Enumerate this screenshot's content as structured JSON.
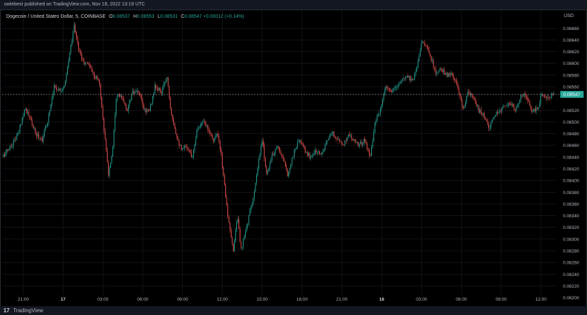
{
  "header": {
    "publish_text": "owlebest published on TradingView.com, Nov 18, 2022 13:19 UTC"
  },
  "legend": {
    "symbol": "Dogecoin / United States Dollar, 5, COINBASE",
    "o_label": "O",
    "o_value": "0.08537",
    "h_label": "H",
    "h_value": "0.08553",
    "l_label": "L",
    "l_value": "0.08531",
    "c_label": "C",
    "c_value": "0.08547",
    "change": "+0.00012 (+0.14%)"
  },
  "footer": {
    "logo_text": "17",
    "brand": "TradingView"
  },
  "chart_data": {
    "type": "candlestick",
    "currency_label": "USD",
    "ylim": [
      0.0821,
      0.08672
    ],
    "grid": true,
    "last_price": 0.08547,
    "last_price_label": "0.08547",
    "colors": {
      "up": "#26a69a",
      "down": "#ef5350",
      "grid": "#1c1f27",
      "last": "#26a69a"
    },
    "y_ticks": [
      {
        "value": 0.0866,
        "label": "0.08660"
      },
      {
        "value": 0.0864,
        "label": "0.08640"
      },
      {
        "value": 0.0862,
        "label": "0.08620"
      },
      {
        "value": 0.086,
        "label": "0.08600"
      },
      {
        "value": 0.0858,
        "label": "0.08580"
      },
      {
        "value": 0.0856,
        "label": "0.08560"
      },
      {
        "value": 0.0852,
        "label": "0.08520"
      },
      {
        "value": 0.085,
        "label": "0.08500"
      },
      {
        "value": 0.0848,
        "label": "0.08480"
      },
      {
        "value": 0.0846,
        "label": "0.08460"
      },
      {
        "value": 0.0844,
        "label": "0.08440"
      },
      {
        "value": 0.0842,
        "label": "0.08420"
      },
      {
        "value": 0.084,
        "label": "0.08400"
      },
      {
        "value": 0.0838,
        "label": "0.08380"
      },
      {
        "value": 0.0836,
        "label": "0.08360"
      },
      {
        "value": 0.0834,
        "label": "0.08340"
      },
      {
        "value": 0.0832,
        "label": "0.08320"
      },
      {
        "value": 0.083,
        "label": "0.08300"
      },
      {
        "value": 0.0828,
        "label": "0.08280"
      },
      {
        "value": 0.0826,
        "label": "0.08260"
      },
      {
        "value": 0.0824,
        "label": "0.08240"
      },
      {
        "value": 0.0822,
        "label": "0.08220"
      },
      {
        "value": 0.082,
        "label": "0.08200"
      }
    ],
    "x_ticks": [
      {
        "label": "21:00",
        "hours": 0,
        "bold": false
      },
      {
        "label": "17",
        "hours": 3,
        "bold": true
      },
      {
        "label": "03:00",
        "hours": 6,
        "bold": false
      },
      {
        "label": "06:00",
        "hours": 9,
        "bold": false
      },
      {
        "label": "09:00",
        "hours": 12,
        "bold": false
      },
      {
        "label": "12:00",
        "hours": 15,
        "bold": false
      },
      {
        "label": "15:00",
        "hours": 18,
        "bold": false
      },
      {
        "label": "18:00",
        "hours": 21,
        "bold": false
      },
      {
        "label": "21:00",
        "hours": 24,
        "bold": false
      },
      {
        "label": "18",
        "hours": 27,
        "bold": true
      },
      {
        "label": "03:00",
        "hours": 30,
        "bold": false
      },
      {
        "label": "06:00",
        "hours": 33,
        "bold": false
      },
      {
        "label": "09:00",
        "hours": 36,
        "bold": false
      },
      {
        "label": "12:00",
        "hours": 39,
        "bold": false
      }
    ],
    "x_range_hours": [
      -1.6,
      40.2
    ],
    "candle_interval_hours": 0.0833,
    "anchors": [
      [
        -1.5,
        0.0844
      ],
      [
        -0.8,
        0.0846
      ],
      [
        -0.3,
        0.0848
      ],
      [
        0.2,
        0.08525
      ],
      [
        0.6,
        0.08505
      ],
      [
        1.0,
        0.0848
      ],
      [
        1.5,
        0.0847
      ],
      [
        1.9,
        0.085
      ],
      [
        2.4,
        0.0856
      ],
      [
        2.8,
        0.08555
      ],
      [
        3.2,
        0.0856
      ],
      [
        3.6,
        0.0862
      ],
      [
        3.9,
        0.08665
      ],
      [
        4.2,
        0.0863
      ],
      [
        4.6,
        0.086
      ],
      [
        5.0,
        0.086
      ],
      [
        5.4,
        0.0858
      ],
      [
        5.8,
        0.0857
      ],
      [
        6.2,
        0.0848
      ],
      [
        6.5,
        0.0841
      ],
      [
        6.8,
        0.0845
      ],
      [
        7.1,
        0.0855
      ],
      [
        7.5,
        0.0854
      ],
      [
        7.9,
        0.0852
      ],
      [
        8.3,
        0.0855
      ],
      [
        8.8,
        0.0855
      ],
      [
        9.2,
        0.0852
      ],
      [
        9.6,
        0.0852
      ],
      [
        10.0,
        0.0856
      ],
      [
        10.5,
        0.0855
      ],
      [
        10.9,
        0.0858
      ],
      [
        11.2,
        0.0852
      ],
      [
        11.6,
        0.0848
      ],
      [
        12.0,
        0.0845
      ],
      [
        12.4,
        0.0846
      ],
      [
        12.8,
        0.0844
      ],
      [
        13.2,
        0.0849
      ],
      [
        13.6,
        0.085
      ],
      [
        14.0,
        0.0849
      ],
      [
        14.4,
        0.0847
      ],
      [
        14.7,
        0.0848
      ],
      [
        15.0,
        0.0844
      ],
      [
        15.3,
        0.0838
      ],
      [
        15.6,
        0.0832
      ],
      [
        15.9,
        0.0828
      ],
      [
        16.2,
        0.0834
      ],
      [
        16.5,
        0.0828
      ],
      [
        16.8,
        0.0831
      ],
      [
        17.1,
        0.0834
      ],
      [
        17.5,
        0.0838
      ],
      [
        17.8,
        0.0843
      ],
      [
        18.1,
        0.0847
      ],
      [
        18.4,
        0.0841
      ],
      [
        18.8,
        0.0844
      ],
      [
        19.2,
        0.0846
      ],
      [
        19.6,
        0.0844
      ],
      [
        20.0,
        0.0841
      ],
      [
        20.5,
        0.0845
      ],
      [
        20.9,
        0.0847
      ],
      [
        21.3,
        0.0845
      ],
      [
        21.7,
        0.0844
      ],
      [
        22.1,
        0.0845
      ],
      [
        22.5,
        0.08445
      ],
      [
        23.0,
        0.0847
      ],
      [
        23.4,
        0.0848
      ],
      [
        23.8,
        0.0847
      ],
      [
        24.2,
        0.0846
      ],
      [
        24.6,
        0.0848
      ],
      [
        25.0,
        0.0847
      ],
      [
        25.4,
        0.0846
      ],
      [
        25.8,
        0.0847
      ],
      [
        26.2,
        0.0844
      ],
      [
        26.6,
        0.085
      ],
      [
        27.0,
        0.0852
      ],
      [
        27.4,
        0.0856
      ],
      [
        27.8,
        0.0855
      ],
      [
        28.2,
        0.0856
      ],
      [
        28.6,
        0.0857
      ],
      [
        29.0,
        0.0858
      ],
      [
        29.4,
        0.0857
      ],
      [
        29.8,
        0.086
      ],
      [
        30.1,
        0.0864
      ],
      [
        30.4,
        0.0863
      ],
      [
        30.8,
        0.0861
      ],
      [
        31.2,
        0.0858
      ],
      [
        31.6,
        0.0859
      ],
      [
        32.0,
        0.0858
      ],
      [
        32.4,
        0.0858
      ],
      [
        32.8,
        0.0856
      ],
      [
        33.2,
        0.0852
      ],
      [
        33.6,
        0.0855
      ],
      [
        34.0,
        0.0854
      ],
      [
        34.4,
        0.0852
      ],
      [
        34.8,
        0.0851
      ],
      [
        35.2,
        0.0849
      ],
      [
        35.6,
        0.0851
      ],
      [
        36.0,
        0.0852
      ],
      [
        36.4,
        0.0853
      ],
      [
        36.8,
        0.0853
      ],
      [
        37.2,
        0.0852
      ],
      [
        37.6,
        0.0855
      ],
      [
        38.0,
        0.0854
      ],
      [
        38.4,
        0.0852
      ],
      [
        38.8,
        0.0852
      ],
      [
        39.2,
        0.0855
      ],
      [
        39.6,
        0.0854
      ],
      [
        40.0,
        0.08547
      ]
    ],
    "volatility": 8e-05
  }
}
